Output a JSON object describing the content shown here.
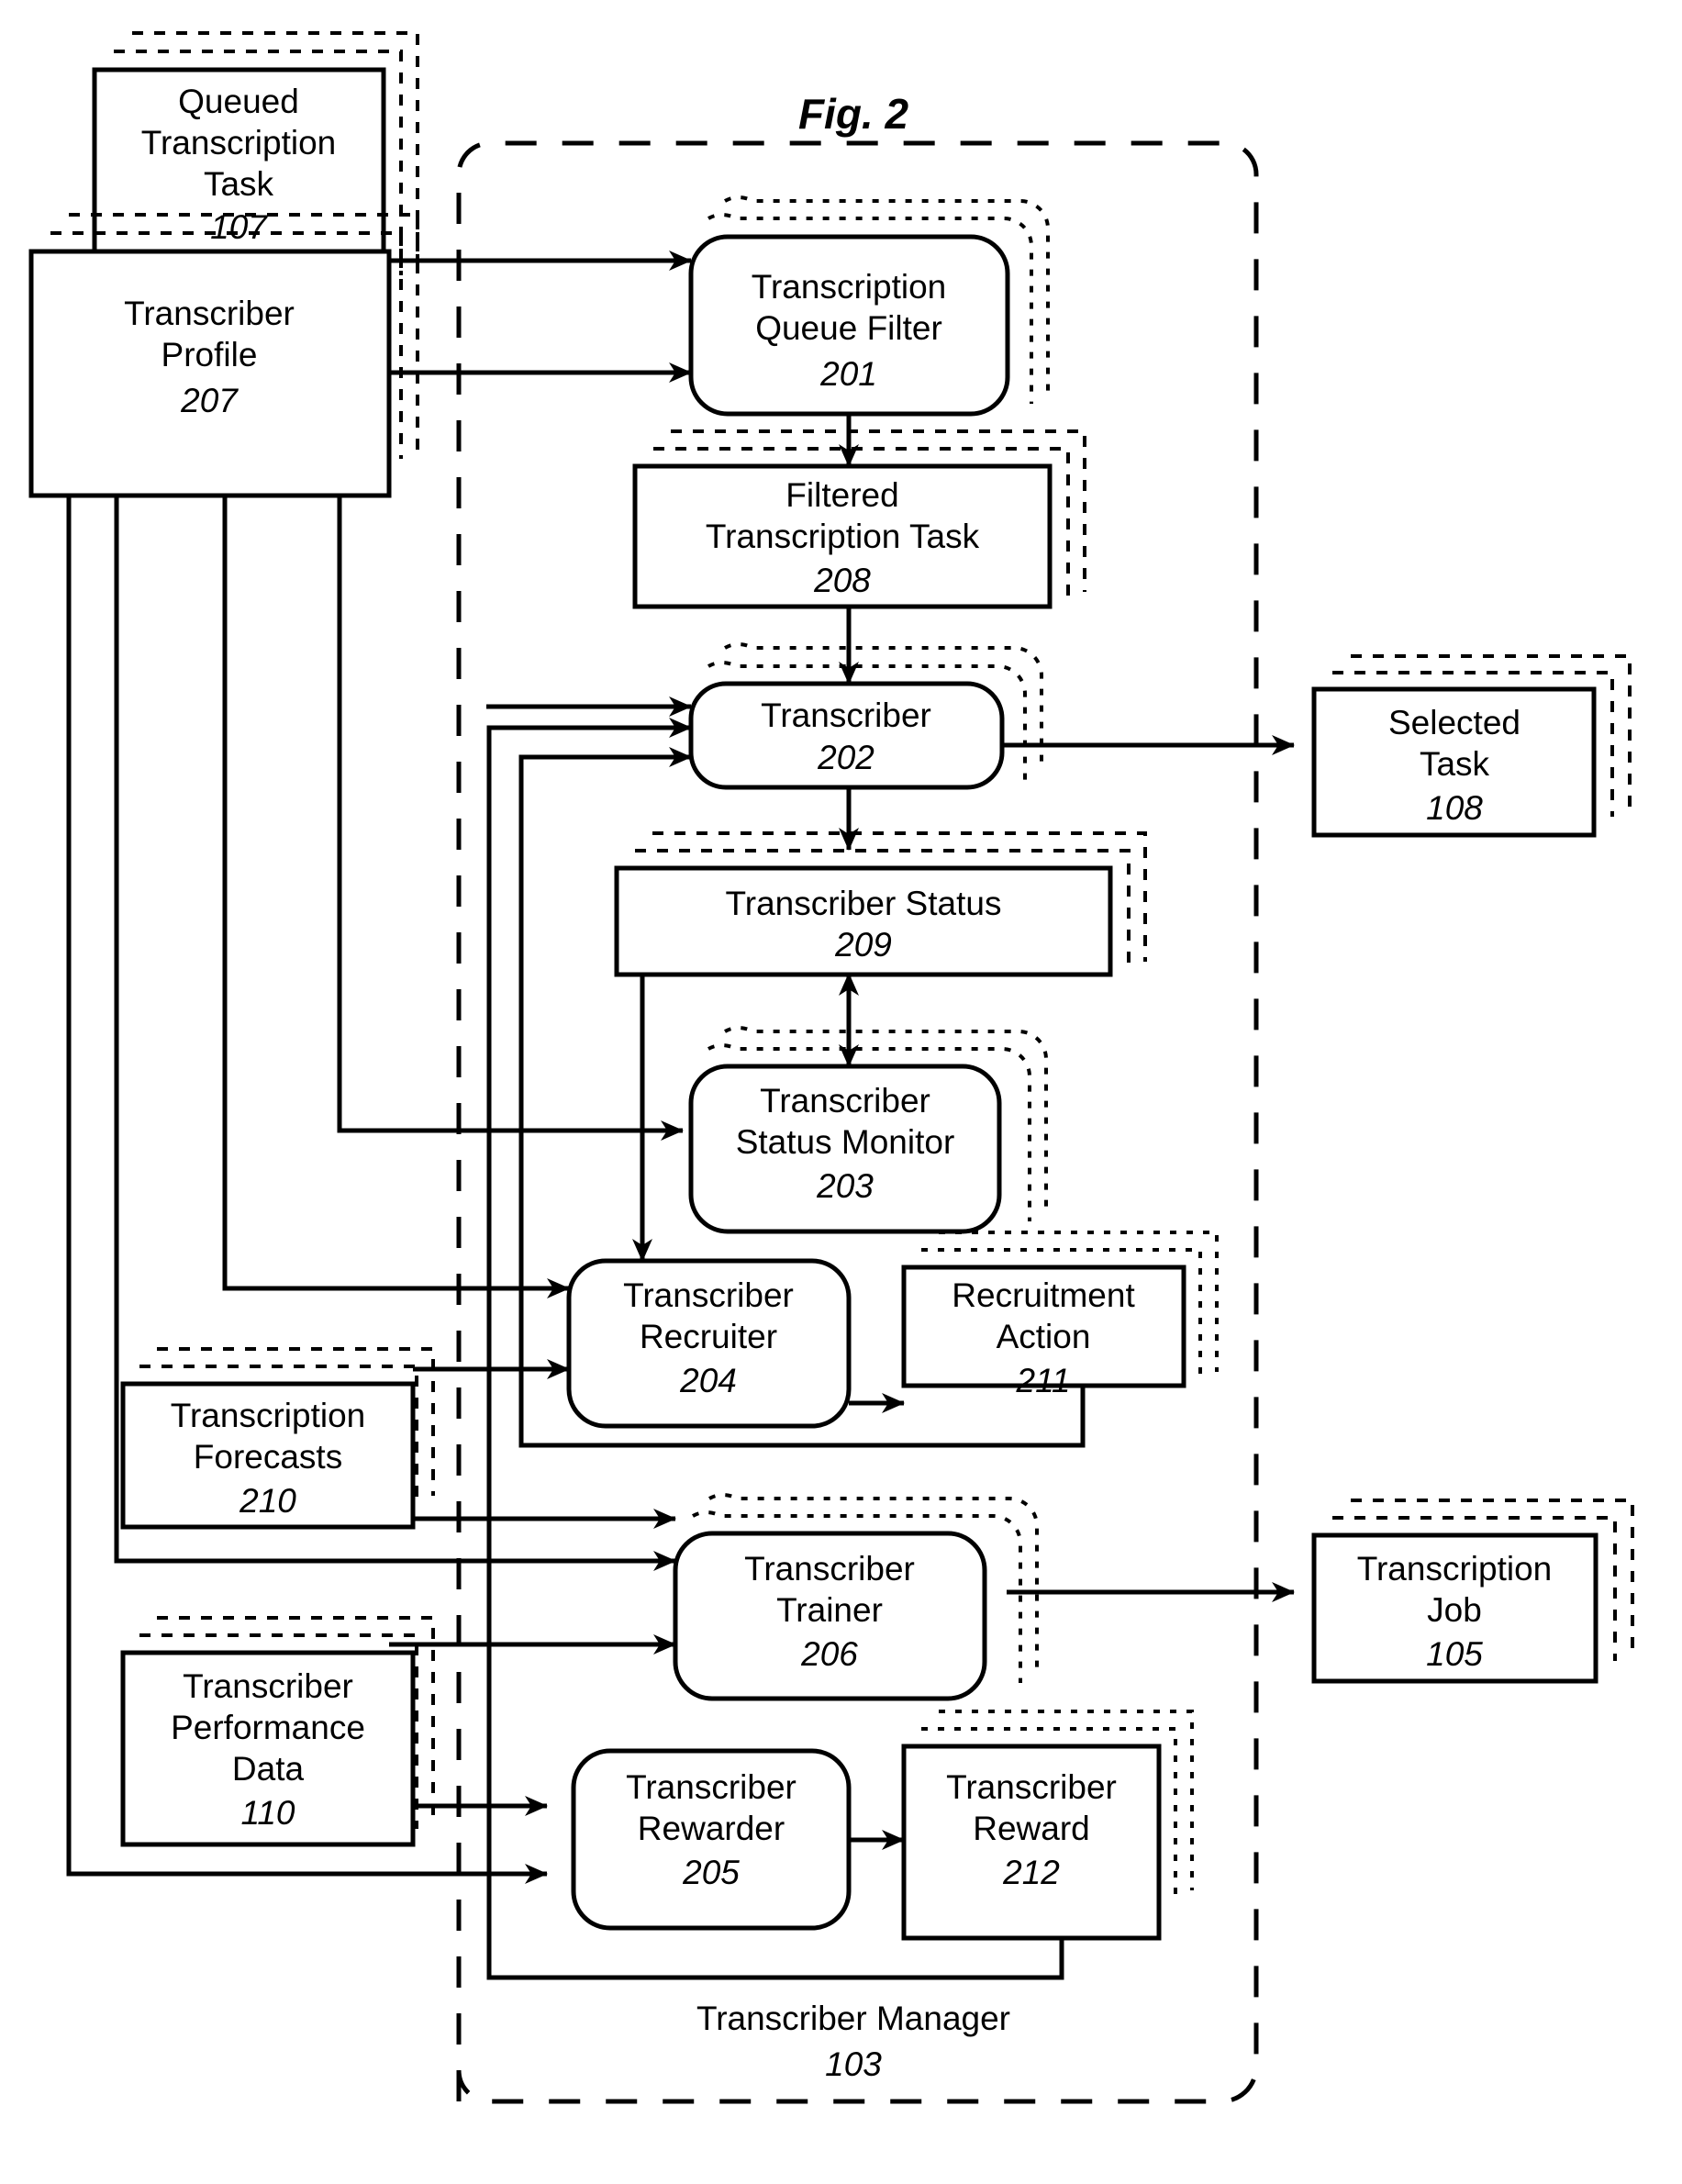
{
  "figure": {
    "title": "Fig. 2"
  },
  "container": {
    "label": "Transcriber Manager",
    "number": "103",
    "style": "dashed-rounded-boundary"
  },
  "nodes": [
    {
      "id": "n107",
      "label_line1": "Queued",
      "label_line2": "Transcription",
      "label_line3": "Task",
      "number": "107",
      "shape": "rect",
      "stacked": true
    },
    {
      "id": "n207",
      "label_line1": "Transcriber",
      "label_line2": "Profile",
      "label_line3": "",
      "number": "207",
      "shape": "rect",
      "stacked": true
    },
    {
      "id": "n201",
      "label_line1": "Transcription",
      "label_line2": "Queue Filter",
      "label_line3": "",
      "number": "201",
      "shape": "rounded",
      "stacked": true
    },
    {
      "id": "n208",
      "label_line1": "Filtered",
      "label_line2": "Transcription Task",
      "label_line3": "",
      "number": "208",
      "shape": "rect",
      "stacked": true
    },
    {
      "id": "n202",
      "label_line1": "Transcriber",
      "label_line2": "",
      "label_line3": "",
      "number": "202",
      "shape": "rounded",
      "stacked": true
    },
    {
      "id": "n108",
      "label_line1": "Selected",
      "label_line2": "Task",
      "label_line3": "",
      "number": "108",
      "shape": "rect",
      "stacked": true
    },
    {
      "id": "n209",
      "label_line1": "Transcriber Status",
      "label_line2": "",
      "label_line3": "",
      "number": "209",
      "shape": "rect",
      "stacked": true
    },
    {
      "id": "n203",
      "label_line1": "Transcriber",
      "label_line2": "Status Monitor",
      "label_line3": "",
      "number": "203",
      "shape": "rounded",
      "stacked": true
    },
    {
      "id": "n204",
      "label_line1": "Transcriber",
      "label_line2": "Recruiter",
      "label_line3": "",
      "number": "204",
      "shape": "rounded",
      "stacked": false
    },
    {
      "id": "n211",
      "label_line1": "Recruitment",
      "label_line2": "Action",
      "label_line3": "",
      "number": "211",
      "shape": "rect",
      "stacked": true
    },
    {
      "id": "n210",
      "label_line1": "Transcription",
      "label_line2": "Forecasts",
      "label_line3": "",
      "number": "210",
      "shape": "rect",
      "stacked": true
    },
    {
      "id": "n206",
      "label_line1": "Transcriber",
      "label_line2": "Trainer",
      "label_line3": "",
      "number": "206",
      "shape": "rounded",
      "stacked": true
    },
    {
      "id": "n105",
      "label_line1": "Transcription",
      "label_line2": "Job",
      "label_line3": "",
      "number": "105",
      "shape": "rect",
      "stacked": true
    },
    {
      "id": "n110",
      "label_line1": "Transcriber",
      "label_line2": "Performance",
      "label_line3": "Data",
      "number": "110",
      "shape": "rect",
      "stacked": true
    },
    {
      "id": "n205",
      "label_line1": "Transcriber",
      "label_line2": "Rewarder",
      "label_line3": "",
      "number": "205",
      "shape": "rounded",
      "stacked": false
    },
    {
      "id": "n212",
      "label_line1": "Transcriber",
      "label_line2": "Reward",
      "label_line3": "",
      "number": "212",
      "shape": "rect",
      "stacked": true
    }
  ],
  "edges": [
    {
      "from": "n107",
      "to": "n201",
      "arrow": "single"
    },
    {
      "from": "n207",
      "to": "n201",
      "arrow": "single"
    },
    {
      "from": "n201",
      "to": "n208",
      "arrow": "single"
    },
    {
      "from": "n208",
      "to": "n202",
      "arrow": "single"
    },
    {
      "from": "n202",
      "to": "n108",
      "arrow": "single"
    },
    {
      "from": "n202",
      "to": "n209",
      "arrow": "single"
    },
    {
      "from": "n209",
      "to": "n203",
      "arrow": "double"
    },
    {
      "from": "n207",
      "to": "n202",
      "arrow": "single"
    },
    {
      "from": "n207",
      "to": "n203",
      "arrow": "single"
    },
    {
      "from": "n207",
      "to": "n204",
      "arrow": "single"
    },
    {
      "from": "n207",
      "to": "n206",
      "arrow": "single"
    },
    {
      "from": "n207",
      "to": "n205",
      "arrow": "single"
    },
    {
      "from": "n209",
      "to": "n204",
      "arrow": "single"
    },
    {
      "from": "n210",
      "to": "n204",
      "arrow": "single"
    },
    {
      "from": "n210",
      "to": "n206",
      "arrow": "single"
    },
    {
      "from": "n204",
      "to": "n211",
      "arrow": "single"
    },
    {
      "from": "n211",
      "to": "n202",
      "arrow": "single"
    },
    {
      "from": "n110",
      "to": "n206",
      "arrow": "single"
    },
    {
      "from": "n110",
      "to": "n205",
      "arrow": "single"
    },
    {
      "from": "n206",
      "to": "n105",
      "arrow": "single"
    },
    {
      "from": "n205",
      "to": "n212",
      "arrow": "single"
    },
    {
      "from": "n212",
      "to": "n202",
      "arrow": "single"
    }
  ],
  "colors": {
    "ink": "#000000",
    "paper": "#ffffff"
  }
}
